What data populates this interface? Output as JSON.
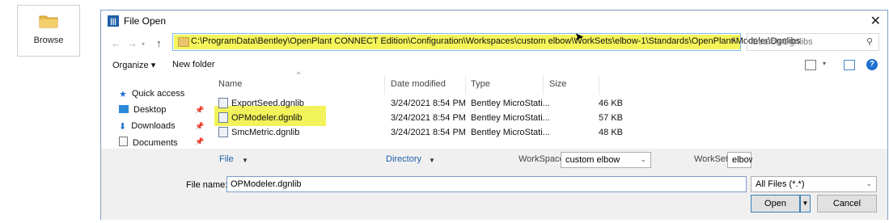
{
  "browse": {
    "label": "Browse"
  },
  "dialog": {
    "title": "File Open",
    "path": "C:\\ProgramData\\Bentley\\OpenPlant CONNECT Edition\\Configuration\\Workspaces\\custom elbow\\WorkSets\\elbow-1\\Standards\\OpenPlant\\Modeler\\Dgnlibs",
    "search_placeholder": "Search Dgnlibs",
    "toolbar": {
      "organize": "Organize ▾",
      "new_folder": "New folder"
    },
    "nav": [
      {
        "label": "Quick access"
      },
      {
        "label": "Desktop"
      },
      {
        "label": "Downloads"
      },
      {
        "label": "Documents"
      }
    ],
    "columns": {
      "name": "Name",
      "date": "Date modified",
      "type": "Type",
      "size": "Size"
    },
    "files": [
      {
        "name": "ExportSeed.dgnlib",
        "date": "3/24/2021 8:54 PM",
        "type": "Bentley MicroStati...",
        "size": "46 KB"
      },
      {
        "name": "OPModeler.dgnlib",
        "date": "3/24/2021 8:54 PM",
        "type": "Bentley MicroStati...",
        "size": "57 KB"
      },
      {
        "name": "SmcMetric.dgnlib",
        "date": "3/24/2021 8:54 PM",
        "type": "Bentley MicroStati...",
        "size": "48 KB"
      }
    ],
    "filters": {
      "file": "File",
      "directory": "Directory",
      "workspace_label": "WorkSpace",
      "workspace_value": "custom elbow",
      "workset_label": "WorkSet",
      "workset_value": "elbow"
    },
    "file_name_label": "File name:",
    "file_name_value": "OPModeler.dgnlib",
    "filetype_value": "All Files (*.*)",
    "open_label": "Open",
    "cancel_label": "Cancel"
  },
  "colors": {
    "highlight": "#f2f25a",
    "accent": "#1f6fd0"
  }
}
